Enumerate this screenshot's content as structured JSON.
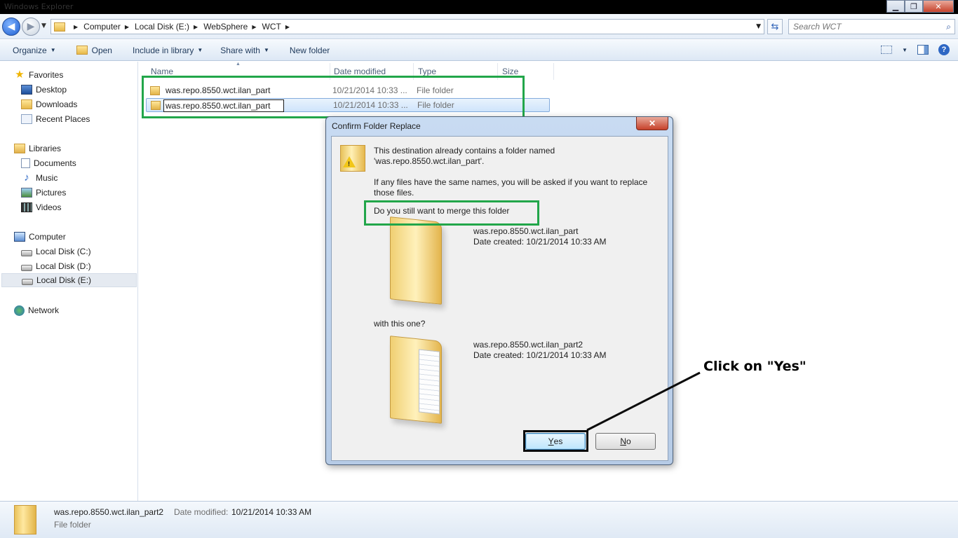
{
  "window": {
    "title_ghost": "Windows Explorer",
    "min_glyph": "▁",
    "max_glyph": "❐",
    "close_glyph": "✕"
  },
  "address": {
    "back_glyph": "◀",
    "forward_glyph": "▶",
    "dropdown_glyph": "▼",
    "crumbs": [
      "Computer",
      "Local Disk (E:)",
      "WebSphere",
      "WCT"
    ],
    "crumb_sep": "▶",
    "refresh_glyph": "⇆",
    "search_placeholder": "Search WCT",
    "search_glyph": "⌕"
  },
  "toolbar": {
    "organize": "Organize",
    "open": "Open",
    "include_in_library": "Include in library",
    "share_with": "Share with",
    "new_folder": "New folder",
    "dropdown_glyph": "▼",
    "help_glyph": "?"
  },
  "navpane": {
    "favorites": "Favorites",
    "desktop": "Desktop",
    "downloads": "Downloads",
    "recent_places": "Recent Places",
    "libraries": "Libraries",
    "documents": "Documents",
    "music": "Music",
    "pictures": "Pictures",
    "videos": "Videos",
    "computer": "Computer",
    "local_c": "Local Disk (C:)",
    "local_d": "Local Disk (D:)",
    "local_e": "Local Disk (E:)",
    "network": "Network",
    "star_glyph": "★",
    "music_glyph": "♪"
  },
  "filelist": {
    "columns": {
      "name": "Name",
      "date_modified": "Date modified",
      "type": "Type",
      "size": "Size"
    },
    "sort_glyph": "▲",
    "rows": [
      {
        "name": "was.repo.8550.wct.ilan_part",
        "date": "10/21/2014 10:33 ...",
        "type": "File folder"
      },
      {
        "name": "was.repo.8550.wct.ilan_part",
        "date": "10/21/2014 10:33 ...",
        "type": "File folder"
      }
    ]
  },
  "dialog": {
    "title": "Confirm Folder Replace",
    "close_glyph": "✕",
    "line1": "This destination already contains a folder named",
    "line2": "'was.repo.8550.wct.ilan_part'.",
    "line3": "If any files have the same names, you will be asked if you want to replace",
    "line4": "those files.",
    "question": "Do you still want to merge this folder",
    "dest_name": "was.repo.8550.wct.ilan_part",
    "dest_created": "Date created: 10/21/2014 10:33 AM",
    "with_this_one": "with this one?",
    "src_name": "was.repo.8550.wct.ilan_part2",
    "src_created": "Date created: 10/21/2014 10:33 AM",
    "yes_first": "Y",
    "yes_rest": "es",
    "no_first": "N",
    "no_rest": "o"
  },
  "annotation": {
    "text": "Click on \"Yes\"",
    "highlight_color": "#22a64a",
    "callout_color": "#0b0b0b"
  },
  "details": {
    "name": "was.repo.8550.wct.ilan_part2",
    "modified_label": "Date modified:",
    "modified_value": "10/21/2014 10:33 AM",
    "type": "File folder"
  }
}
